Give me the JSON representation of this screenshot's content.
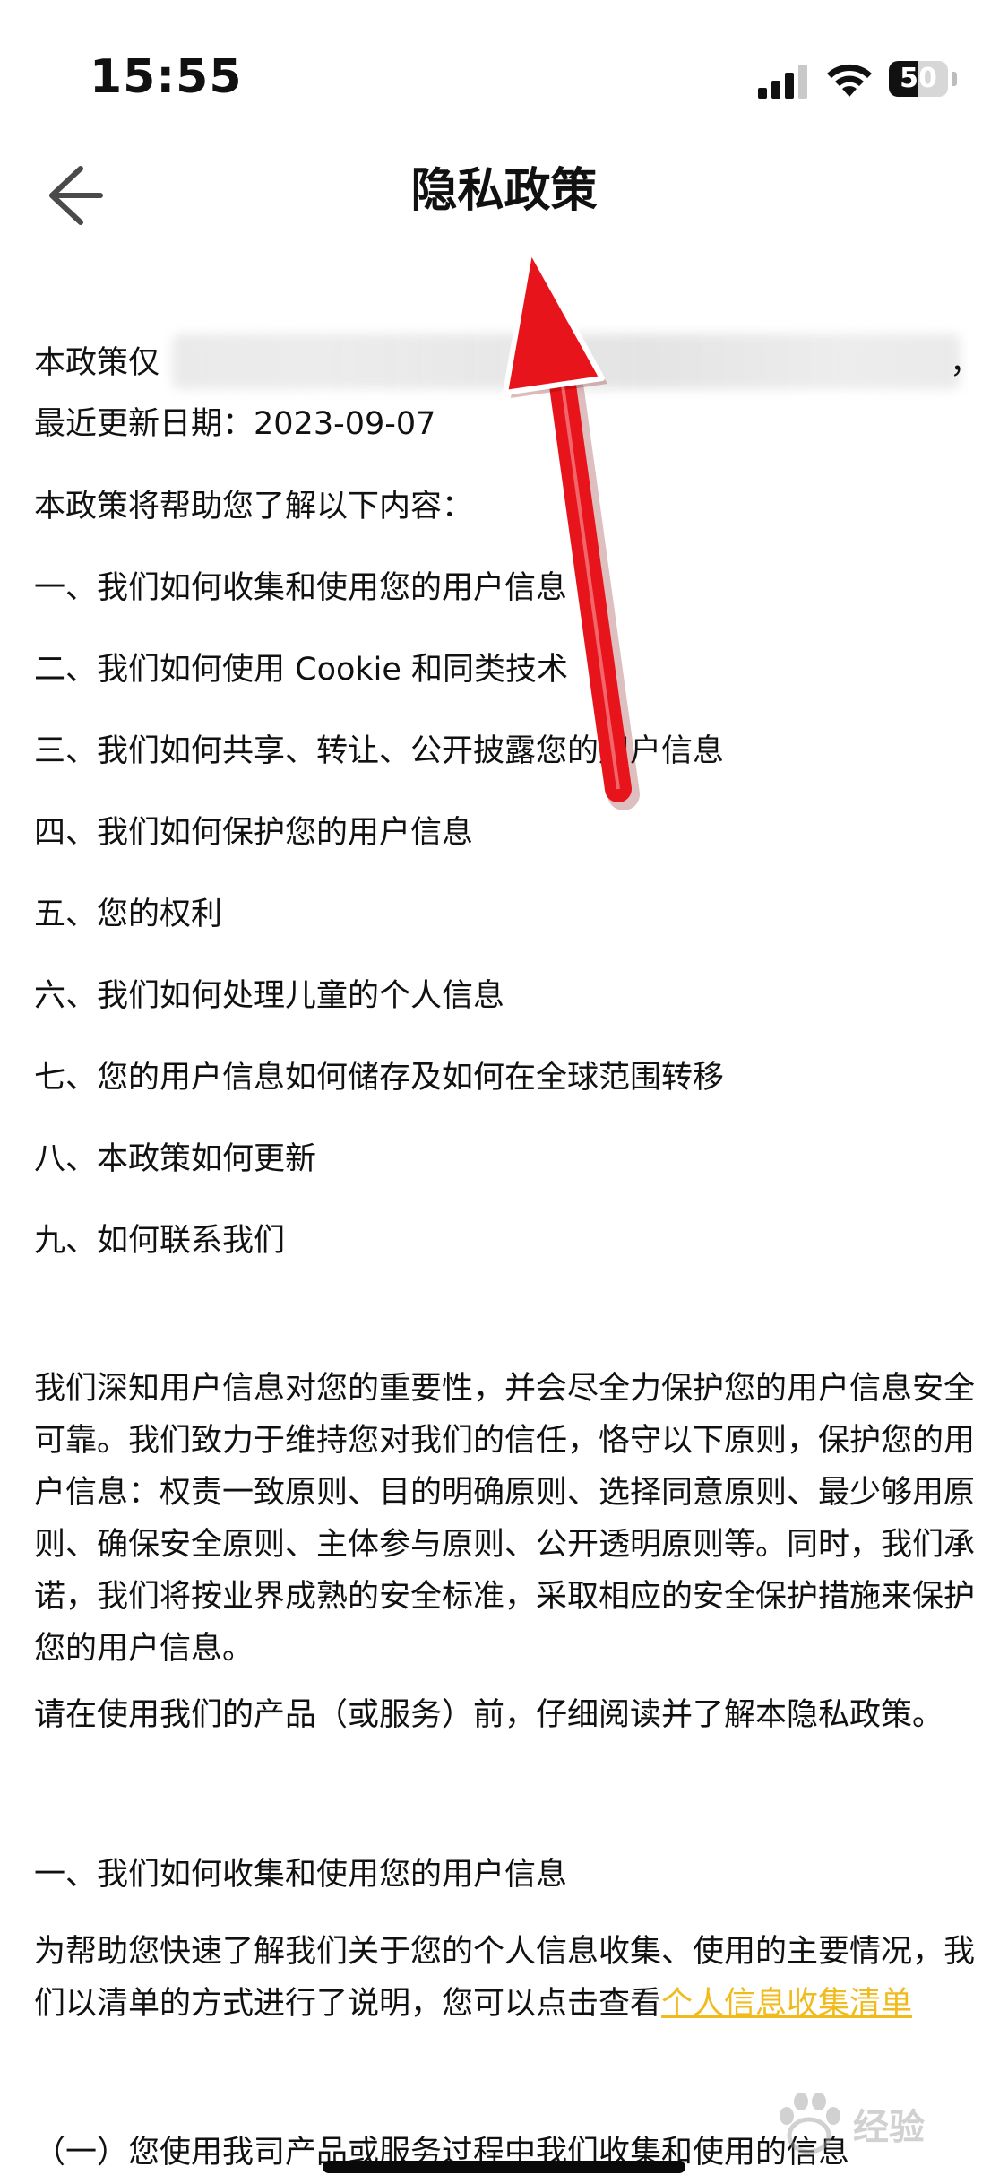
{
  "status_bar": {
    "time": "15:55",
    "battery_level": "50",
    "battery_fraction": 0.5,
    "icons": [
      "cellular-signal-icon",
      "wifi-icon",
      "battery-icon"
    ]
  },
  "nav": {
    "title": "隐私政策",
    "back_icon": "arrow-left-icon"
  },
  "intro": {
    "policy_prefix": "本政策仅",
    "trailing_comma": "，",
    "updated_label": "最近更新日期：",
    "updated_date": "2023-09-07",
    "help_line": "本政策将帮助您了解以下内容："
  },
  "toc": [
    "一、我们如何收集和使用您的用户信息",
    "二、我们如何使用 Cookie 和同类技术",
    "三、我们如何共享、转让、公开披露您的用户信息",
    "四、我们如何保护您的用户信息",
    "五、您的权利",
    "六、我们如何处理儿童的个人信息",
    "七、您的用户信息如何储存及如何在全球范围转移",
    "八、本政策如何更新",
    "九、如何联系我们"
  ],
  "body": {
    "principles": "我们深知用户信息对您的重要性，并会尽全力保护您的用户信息安全可靠。我们致力于维持您对我们的信任，恪守以下原则，保护您的用户信息：权责一致原则、目的明确原则、选择同意原则、最少够用原则、确保安全原则、主体参与原则、公开透明原则等。同时，我们承诺，我们将按业界成熟的安全标准，采取相应的安全保护措施来保护您的用户信息。",
    "read_notice": "请在使用我们的产品（或服务）前，仔细阅读并了解本隐私政策。",
    "section1_heading": "一、我们如何收集和使用您的用户信息",
    "section1_text": "为帮助您快速了解我们关于您的个人信息收集、使用的主要情况，我们以清单的方式进行了说明，您可以点击查看",
    "section1_link": "个人信息收集清单",
    "subsection": "（一）您使用我司产品或服务过程中我们收集和使用的信息"
  },
  "watermark": {
    "text": "经验",
    "logo": "baidu-paw-icon"
  },
  "colors": {
    "link": "#f1ba1d",
    "arrow": "#e8141c",
    "text": "#111111",
    "background": "#ffffff"
  }
}
